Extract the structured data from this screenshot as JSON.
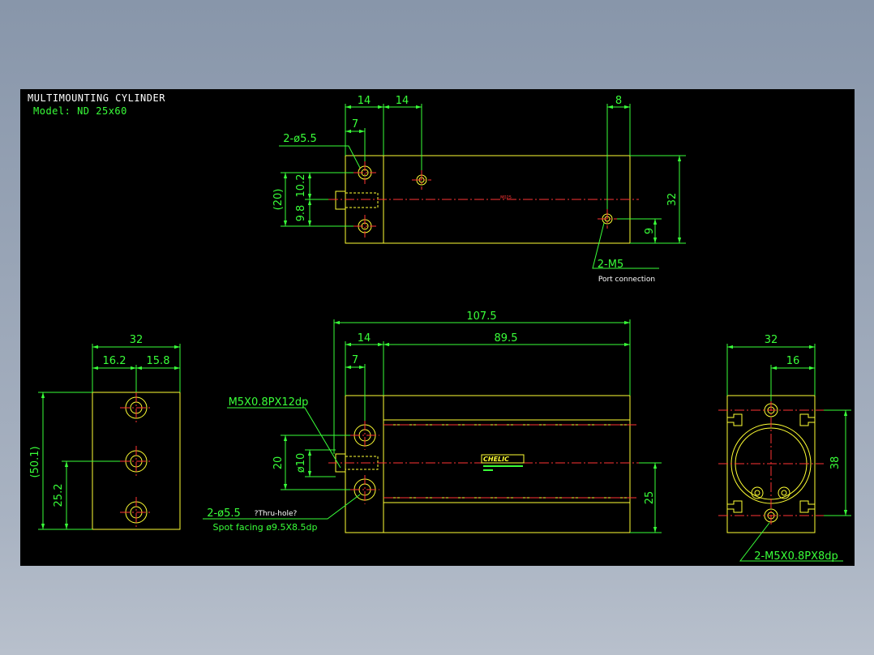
{
  "drawing": {
    "title": "MULTIMOUNTING CYLINDER",
    "model": "Model: ND 25x60"
  },
  "colors": {
    "background": "#000000",
    "outline": "#ffff33",
    "dimension": "#39ff39",
    "centerline": "#ff3333",
    "text": "#ffffff"
  },
  "top_view": {
    "dims": {
      "d14a": "14",
      "d14b": "14",
      "d8": "8",
      "d7": "7",
      "d20": "(20)",
      "d10_2": "10.2",
      "d9_8": "9.8",
      "d32": "32",
      "d9": "9"
    },
    "labels": {
      "holes": "2-ø5.5",
      "port": "2-M5",
      "port_note": "Port connection",
      "center_mark": "M025"
    }
  },
  "front_view": {
    "dims": {
      "total": "107.5",
      "d14": "14",
      "d89_5": "89.5",
      "d7": "7",
      "d20": "20",
      "phi10": "ø10",
      "d25": "25"
    },
    "labels": {
      "thread": "M5X0.8PX12dp",
      "holes": "2-ø5.5",
      "thru": "?Thru-hole?",
      "spot": "Spot facing  ø9.5X8.5dp",
      "brand": "CHELIC"
    }
  },
  "left_view": {
    "dims": {
      "d32": "32",
      "d16_2": "16.2",
      "d15_8": "15.8",
      "d50_1": "(50.1)",
      "d25_2": "25.2"
    }
  },
  "right_view": {
    "dims": {
      "d32": "32",
      "d16": "16",
      "d38": "38"
    },
    "labels": {
      "thread": "2-M5X0.8PX8dp"
    }
  }
}
